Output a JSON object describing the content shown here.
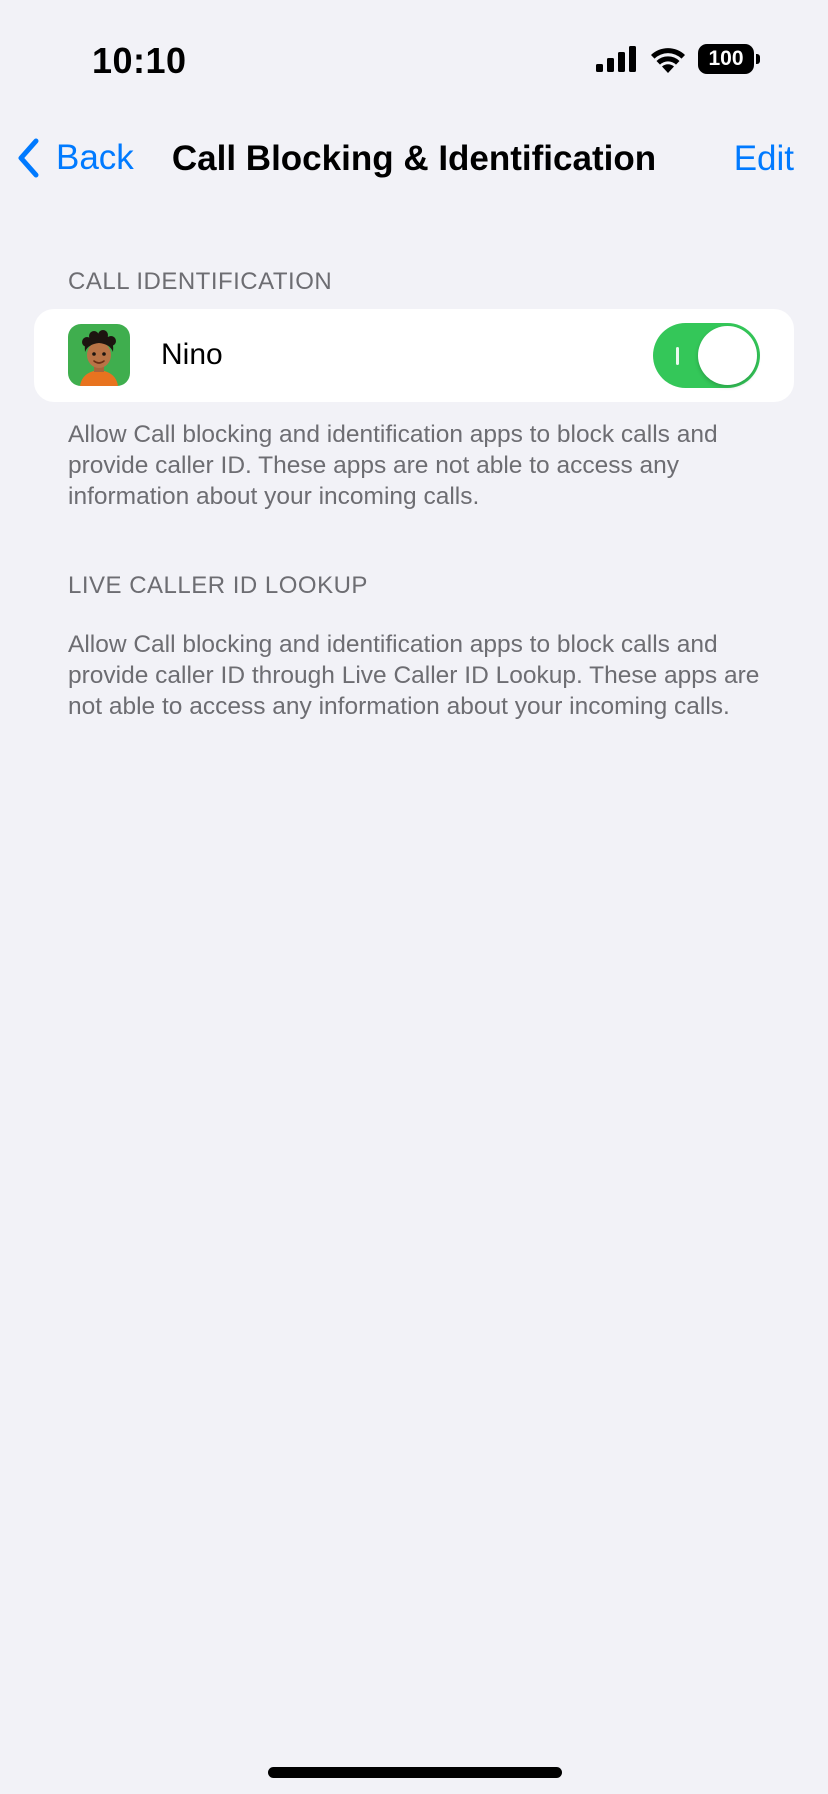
{
  "status_bar": {
    "time": "10:10",
    "battery": "100",
    "icons": [
      "cellular-signal-icon",
      "wifi-icon",
      "battery-icon"
    ]
  },
  "nav": {
    "back_label": "Back",
    "title": "Call Blocking & Identification",
    "edit_label": "Edit"
  },
  "call_identification": {
    "header": "CALL IDENTIFICATION",
    "apps": [
      {
        "name": "Nino",
        "enabled": true,
        "icon": "nino-app-icon"
      }
    ],
    "footer": "Allow Call blocking and identification apps to block calls and provide caller ID. These apps are not able to access any information about your incoming calls."
  },
  "live_caller_id": {
    "header": "LIVE CALLER ID LOOKUP",
    "footer": "Allow Call blocking and identification apps to block calls and provide caller ID through Live Caller ID Lookup. These apps are not able to access any information about your incoming calls."
  },
  "colors": {
    "accent": "#007aff",
    "toggle_on": "#34c759",
    "background": "#f2f2f7",
    "secondary_text": "#6d6d72"
  }
}
